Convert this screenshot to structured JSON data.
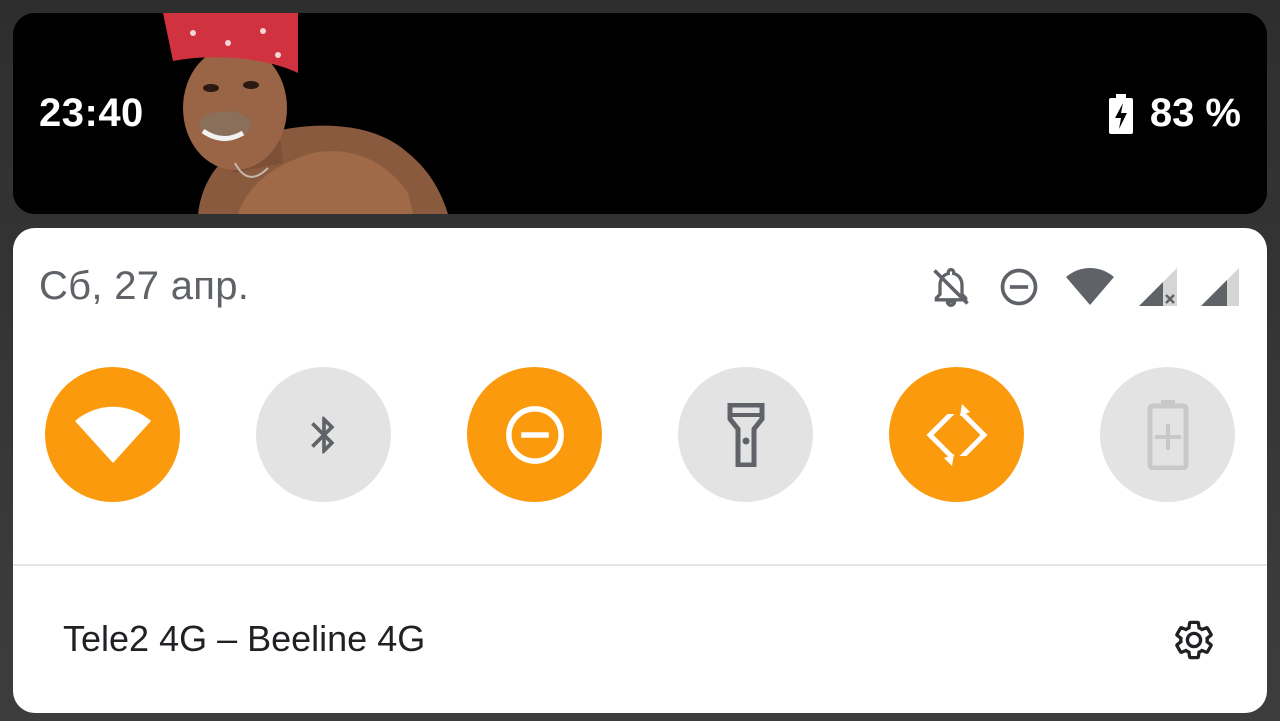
{
  "status_bar": {
    "time": "23:40",
    "battery_percent": "83 %",
    "battery_icon": "battery-charging-icon",
    "wallpaper": "wallpaper-photo"
  },
  "panel": {
    "date": "Сб, 27 апр.",
    "header_icons": [
      "notifications-off-icon",
      "do-not-disturb-icon",
      "wifi-signal-icon",
      "sim1-signal-no-data-icon",
      "sim2-signal-icon"
    ]
  },
  "tiles": [
    {
      "name": "wifi",
      "icon": "wifi-icon",
      "state": "on"
    },
    {
      "name": "bluetooth",
      "icon": "bluetooth-icon",
      "state": "off"
    },
    {
      "name": "do-not-disturb",
      "icon": "do-not-disturb-icon",
      "state": "on"
    },
    {
      "name": "flashlight",
      "icon": "flashlight-icon",
      "state": "off"
    },
    {
      "name": "auto-rotate",
      "icon": "auto-rotate-icon",
      "state": "on"
    },
    {
      "name": "battery-saver",
      "icon": "battery-saver-icon",
      "state": "unavailable"
    }
  ],
  "footer": {
    "carrier_text": "Tele2 4G – Beeline 4G",
    "settings_icon": "gear-icon"
  },
  "colors": {
    "accent": "#fb9a0c",
    "tile_off": "#e3e3e3",
    "panel_bg": "#ffffff",
    "status_bg": "#000000"
  }
}
